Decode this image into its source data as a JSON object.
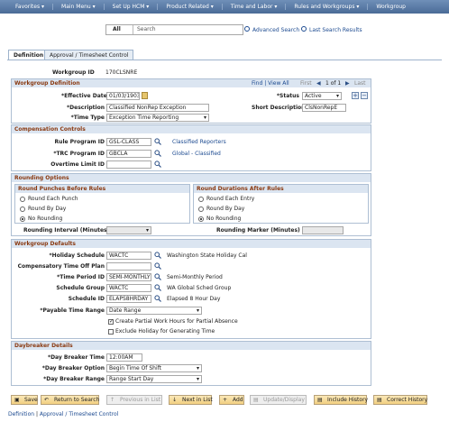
{
  "menu": [
    "Favorites ▾",
    "Main Menu ▾",
    "Set Up HCM ▾",
    "Product Related ▾",
    "Time and Labor ▾",
    "Rules and Workgroups ▾",
    "Workgroup"
  ],
  "search": {
    "scope": "All",
    "placeholder": "Search",
    "advanced": "Advanced Search",
    "last": "Last Search Results"
  },
  "tabs": [
    "Definition",
    "Approval / Timesheet Control"
  ],
  "workgroup_id_label": "Workgroup ID",
  "workgroup_id": "170CLSNRE",
  "def": {
    "title": "Workgroup Definition",
    "nav": "Find | View All",
    "first": "First",
    "pager": "1 of 1",
    "last": "Last",
    "eff_date_label": "*Effective Date",
    "eff_date": "01/03/1903",
    "status_label": "*Status",
    "status": "Active",
    "desc_label": "*Description",
    "desc": "Classified NonRep Exception",
    "short_label": "Short Description",
    "short": "ClsNonRepE",
    "time_type_label": "*Time Type",
    "time_type": "Exception Time Reporting"
  },
  "comp": {
    "title": "Compensation Controls",
    "rule_label": "Rule Program ID",
    "rule": "GSL-CLASS",
    "rule_desc": "Classified Reporters",
    "trc_label": "*TRC Program ID",
    "trc": "GBCLA",
    "trc_desc": "Global - Classified",
    "ot_label": "Overtime Limit ID",
    "ot": ""
  },
  "round": {
    "title": "Rounding Options",
    "before_title": "Round Punches Before Rules",
    "before_opts": [
      "Round Each Punch",
      "Round By Day",
      "No Rounding"
    ],
    "after_title": "Round Durations After Rules",
    "after_opts": [
      "Round Each Entry",
      "Round By Day",
      "No Rounding"
    ],
    "interval_label": "Rounding Interval (Minutes)",
    "marker_label": "Rounding Marker (Minutes)"
  },
  "defaults": {
    "title": "Workgroup Defaults",
    "holiday_label": "*Holiday Schedule",
    "holiday": "WACTC",
    "holiday_desc": "Washington State Holiday Cal",
    "comp_label": "Compensatory Time Off Plan",
    "comp": "",
    "period_label": "*Time Period ID",
    "period": "SEMI-MONTHLY",
    "period_desc": "Semi-Monthly Period",
    "group_label": "Schedule Group",
    "group": "WACTC",
    "group_desc": "WA Global Sched Group",
    "sched_label": "Schedule ID",
    "sched": "ELAPS8HRDAY",
    "sched_desc": "Elapsed 8 Hour Day",
    "payable_label": "*Payable Time Range",
    "payable": "Date Range",
    "chk1": "Create Partial Work Hours for Partial Absence",
    "chk2": "Exclude Holiday for Generating Time"
  },
  "day": {
    "title": "Daybreaker Details",
    "time_label": "*Day Breaker Time",
    "time": "12:00AM",
    "opt_label": "*Day Breaker Option",
    "opt": "Begin Time Of Shift",
    "range_label": "*Day Breaker Range",
    "range": "Range Start Day"
  },
  "buttons": [
    "Save",
    "Return to Search",
    "Previous in List",
    "Next in List",
    "Add",
    "Update/Display",
    "Include History",
    "Correct History"
  ],
  "footer": {
    "definition": "Definition",
    "sep": " | ",
    "approval": "Approval / Timesheet Control"
  }
}
